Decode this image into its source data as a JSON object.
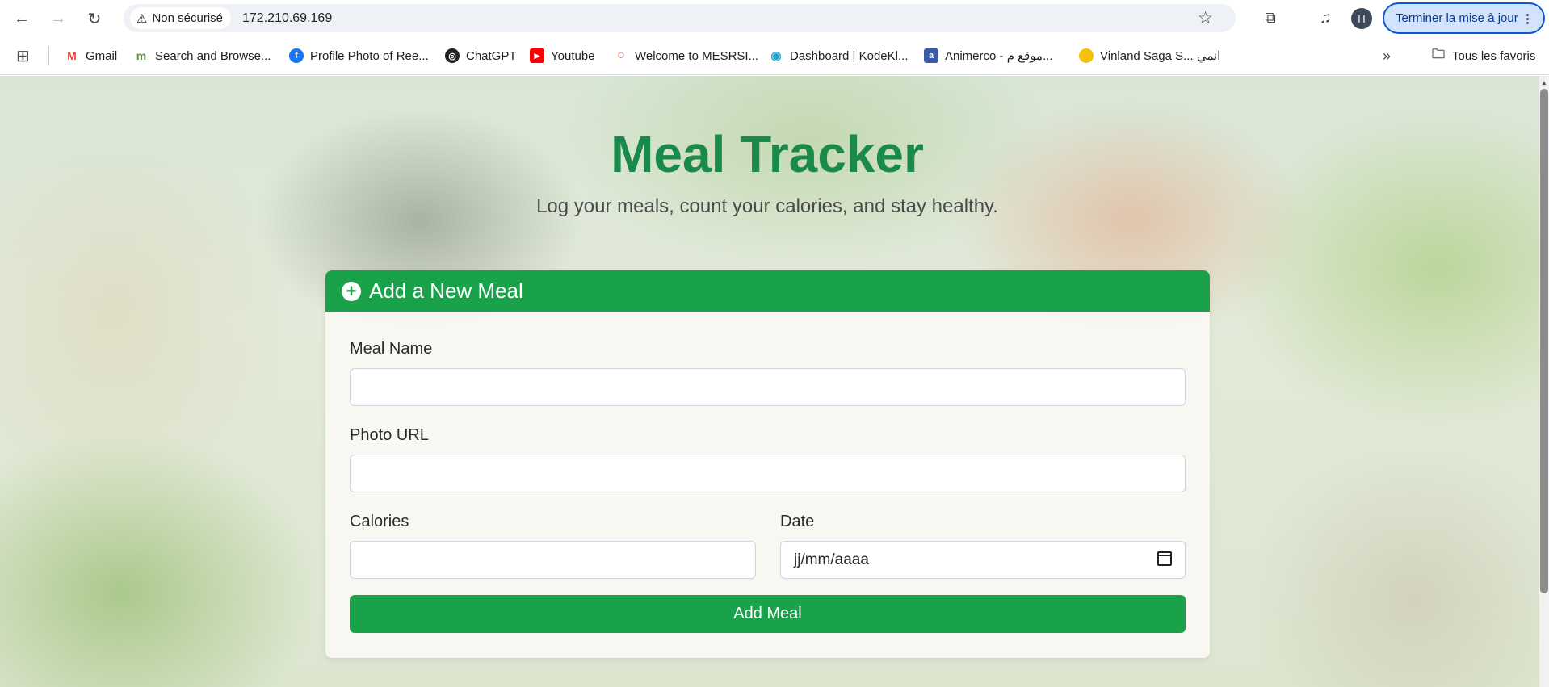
{
  "browser": {
    "security_label": "Non sécurisé",
    "url": "172.210.69.169",
    "profile_initial": "H",
    "update_button": "Terminer la mise à jour",
    "bookmarks": [
      {
        "label": "Gmail",
        "color": "#ea4335",
        "icon": "M"
      },
      {
        "label": "Search and Browse...",
        "color": "#5f8f3e",
        "icon": "m"
      },
      {
        "label": "Profile Photo of Ree...",
        "color": "#1877f2",
        "icon": "f"
      },
      {
        "label": "ChatGPT",
        "color": "#202123",
        "icon": "◎"
      },
      {
        "label": "Youtube",
        "color": "#ff0000",
        "icon": "▶"
      },
      {
        "label": "Welcome to MESRSI...",
        "color": "#e0532b",
        "icon": "○"
      },
      {
        "label": "Dashboard | KodeKl...",
        "color": "#2aa3c9",
        "icon": "◉"
      },
      {
        "label": "Animerco - موقع م...",
        "color": "#3a5aa8",
        "icon": "a"
      },
      {
        "label": "Vinland Saga S... انمي",
        "color": "#f4c20d",
        "icon": "●"
      }
    ],
    "all_bookmarks": "Tous les favoris"
  },
  "page": {
    "title": "Meal Tracker",
    "subtitle": "Log your meals, count your calories, and stay healthy.",
    "form": {
      "header": "Add a New Meal",
      "meal_name_label": "Meal Name",
      "meal_name_value": "",
      "photo_url_label": "Photo URL",
      "photo_url_value": "",
      "calories_label": "Calories",
      "calories_value": "",
      "date_label": "Date",
      "date_placeholder": "jj/mm/aaaa",
      "submit_label": "Add Meal"
    }
  },
  "colors": {
    "accent": "#19a24a",
    "title": "#1a8a4a"
  }
}
